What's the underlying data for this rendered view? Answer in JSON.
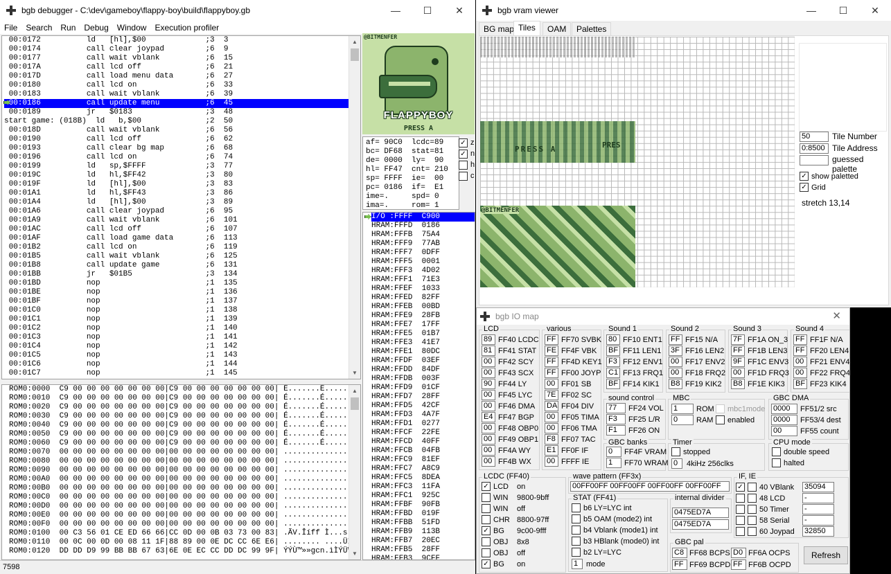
{
  "debugger": {
    "title": "bgb debugger - C:\\dev\\gameboy\\flappy-boy\\build\\flappyboy.gb",
    "menu": [
      "File",
      "Search",
      "Run",
      "Debug",
      "Window",
      "Execution profiler"
    ],
    "code": [
      " 00:0172          ld   [hl],$00             ;3  3",
      " 00:0174          call clear joypad         ;6  9",
      " 00:0177          call wait vblank          ;6  15",
      " 00:017A          call lcd off              ;6  21",
      " 00:017D          call load menu data       ;6  27",
      " 00:0180          call lcd on               ;6  33",
      " 00:0183          call wait vblank          ;6  39",
      " 00:0186          call update menu          ;6  45",
      " 00:0189          jr   $0183                ;3  48",
      "start game: (018B)  ld   b,$00              ;2  50",
      " 00:018D          call wait vblank          ;6  56",
      " 00:0190          call lcd off              ;6  62",
      " 00:0193          call clear bg map         ;6  68",
      " 00:0196          call lcd on               ;6  74",
      " 00:0199          ld   sp,$FFFF             ;3  77",
      " 00:019C          ld   hl,$FF42             ;3  80",
      " 00:019F          ld   [hl],$00             ;3  83",
      " 00:01A1          ld   hl,$FF43             ;3  86",
      " 00:01A4          ld   [hl],$00             ;3  89",
      " 00:01A6          call clear joypad         ;6  95",
      " 00:01A9          call wait vblank          ;6  101",
      " 00:01AC          call lcd off              ;6  107",
      " 00:01AF          call load game data       ;6  113",
      " 00:01B2          call lcd on               ;6  119",
      " 00:01B5          call wait vblank          ;6  125",
      " 00:01B8          call update game          ;6  131",
      " 00:01BB          jr   $01B5                ;3  134",
      " 00:01BD          nop                       ;1  135",
      " 00:01BE          nop                       ;1  136",
      " 00:01BF          nop                       ;1  137",
      " 00:01C0          nop                       ;1  138",
      " 00:01C1          nop                       ;1  139",
      " 00:01C2          nop                       ;1  140",
      " 00:01C3          nop                       ;1  141",
      " 00:01C4          nop                       ;1  142",
      " 00:01C5          nop                       ;1  143",
      " 00:01C6          nop                       ;1  144",
      " 00:01C7          nop                       ;1  145"
    ],
    "hex": [
      "ROM0:0000  C9 00 00 00 00 00 00 00|C9 00 00 00 00 00 00 00| É.......É.......",
      "ROM0:0010  C9 00 00 00 00 00 00 00|C9 00 00 00 00 00 00 00| É.......É.......",
      "ROM0:0020  C9 00 00 00 00 00 00 00|C9 00 00 00 00 00 00 00| É.......É.......",
      "ROM0:0030  C9 00 00 00 00 00 00 00|C9 00 00 00 00 00 00 00| É.......É.......",
      "ROM0:0040  C9 00 00 00 00 00 00 00|C9 00 00 00 00 00 00 00| É.......É.......",
      "ROM0:0050  C9 00 00 00 00 00 00 00|C9 00 00 00 00 00 00 00| É.......É.......",
      "ROM0:0060  C9 00 00 00 00 00 00 00|C9 00 00 00 00 00 00 00| É.......É.......",
      "ROM0:0070  00 00 00 00 00 00 00 00|00 00 00 00 00 00 00 00| ................",
      "ROM0:0080  00 00 00 00 00 00 00 00|00 00 00 00 00 00 00 00| ................",
      "ROM0:0090  00 00 00 00 00 00 00 00|00 00 00 00 00 00 00 00| ................",
      "ROM0:00A0  00 00 00 00 00 00 00 00|00 00 00 00 00 00 00 00| ................",
      "ROM0:00B0  00 00 00 00 00 00 00 00|00 00 00 00 00 00 00 00| ................",
      "ROM0:00C0  00 00 00 00 00 00 00 00|00 00 00 00 00 00 00 00| ................",
      "ROM0:00D0  00 00 00 00 00 00 00 00|00 00 00 00 00 00 00 00| ................",
      "ROM0:00E0  00 00 00 00 00 00 00 00|00 00 00 00 00 00 00 00| ................",
      "ROM0:00F0  00 00 00 00 00 00 00 00|00 00 00 00 00 00 00 00| ................",
      "ROM0:0100  00 C3 56 01 CE ED 66 66|CC 0D 00 0B 03 73 00 83| .ÃV.Îíff Ì...s..",
      "ROM0:0110  00 0C 00 0D 00 08 11 1F|88 89 00 0E DC CC 6E E6| ........ ....ÜÌnæ",
      "ROM0:0120  DD DD D9 99 BB BB 67 63|6E 0E EC CC DD DC 99 9F| ÝÝÙ™»»gcn.ìÌÝÜ™Ÿ"
    ],
    "regs": [
      "af= 90C0  lcdc=89",
      "bc= DF68  stat=81",
      "de= 0000  ly=  90",
      "hl= FF47  cnt= 210",
      "sp= FFFF  ie=  00",
      "pc= 0186  if=  E1",
      "ime=.     spd= 0",
      "ima=.     rom= 1"
    ],
    "flags": [
      "z",
      "n",
      "h",
      "c"
    ],
    "flags_checked": [
      true,
      true,
      false,
      false
    ],
    "stack": [
      "I/O :FFFF  C900",
      "HRAM:FFFD  0186",
      "HRAM:FFFB  75A4",
      "HRAM:FFF9  77AB",
      "HRAM:FFF7  0DFF",
      "HRAM:FFF5  0001",
      "HRAM:FFF3  4D02",
      "HRAM:FFF1  71E3",
      "HRAM:FFEF  1033",
      "HRAM:FFED  82FF",
      "HRAM:FFEB  00BD",
      "HRAM:FFE9  28FB",
      "HRAM:FFE7  17FF",
      "HRAM:FFE5  01B7",
      "HRAM:FFE3  41E7",
      "HRAM:FFE1  80DC",
      "HRAM:FFDF  03EF",
      "HRAM:FFDD  84DF",
      "HRAM:FFDB  003F",
      "HRAM:FFD9  01CF",
      "HRAM:FFD7  28FF",
      "HRAM:FFD5  42CF",
      "HRAM:FFD3  4A7F",
      "HRAM:FFD1  0277",
      "HRAM:FFCF  22FE",
      "HRAM:FFCD  40FF",
      "HRAM:FFCB  04FB",
      "HRAM:FFC9  81EF",
      "HRAM:FFC7  A8C9",
      "HRAM:FFC5  8DEA",
      "HRAM:FFC3  11FA",
      "HRAM:FFC1  925C",
      "HRAM:FFBF  90FB",
      "HRAM:FFBD  019F",
      "HRAM:FFBB  51FD",
      "HRAM:FFB9  113B",
      "HRAM:FFB7  20EC",
      "HRAM:FFB5  28FF",
      "HRAM:FFB3  9CFF"
    ],
    "screen_brand": "@BITMENFER",
    "screen_title": "FLAPPYBOY",
    "screen_press": "PRESS A",
    "status": "7598"
  },
  "vram": {
    "title": "bgb vram viewer",
    "tabs": [
      "BG map",
      "Tiles",
      "OAM",
      "Palettes"
    ],
    "tile_number": "50",
    "tile_number_label": "Tile Number",
    "tile_address": "0:8500",
    "tile_address_label": "Tile Address",
    "guessed_palette": "guessed palette",
    "show_paletted": "show paletted",
    "grid": "Grid",
    "stretch": "stretch 13,14",
    "tile_text1": "@BITMENFER",
    "tile_text2": "PRESS A",
    "tile_text3": "PRES"
  },
  "iomap": {
    "title": "bgb IO map",
    "lcd": {
      "title": "LCD",
      "rows": [
        [
          "89",
          "FF40 LCDC"
        ],
        [
          "81",
          "FF41 STAT"
        ],
        [
          "00",
          "FF42 SCY"
        ],
        [
          "00",
          "FF43 SCX"
        ],
        [
          "90",
          "FF44 LY"
        ],
        [
          "00",
          "FF45 LYC"
        ],
        [
          "00",
          "FF46 DMA"
        ],
        [
          "E4",
          "FF47 BGP"
        ],
        [
          "00",
          "FF48 OBP0"
        ],
        [
          "00",
          "FF49 OBP1"
        ],
        [
          "00",
          "FF4A WY"
        ],
        [
          "00",
          "FF4B WX"
        ]
      ]
    },
    "various": {
      "title": "various",
      "rows": [
        [
          "FF",
          "FF70 SVBK"
        ],
        [
          "FE",
          "FF4F VBK"
        ],
        [
          "FF",
          "FF4D KEY1"
        ],
        [
          "FF",
          "FF00 JOYP"
        ],
        [
          "00",
          "FF01 SB"
        ],
        [
          "7E",
          "FF02 SC"
        ],
        [
          "DA",
          "FF04 DIV"
        ],
        [
          "00",
          "FF05 TIMA"
        ],
        [
          "00",
          "FF06 TMA"
        ],
        [
          "F8",
          "FF07 TAC"
        ],
        [
          "E1",
          "FF0F IF"
        ],
        [
          "00",
          "FFFF IE"
        ]
      ]
    },
    "sound1": {
      "title": "Sound 1",
      "rows": [
        [
          "80",
          "FF10 ENT1"
        ],
        [
          "BF",
          "FF11 LEN1"
        ],
        [
          "F3",
          "FF12 ENV1"
        ],
        [
          "C1",
          "FF13 FRQ1"
        ],
        [
          "BF",
          "FF14 KIK1"
        ]
      ]
    },
    "sound2": {
      "title": "Sound 2",
      "rows": [
        [
          "FF",
          "FF15 N/A"
        ],
        [
          "3F",
          "FF16 LEN2"
        ],
        [
          "00",
          "FF17 ENV2"
        ],
        [
          "00",
          "FF18 FRQ2"
        ],
        [
          "B8",
          "FF19 KIK2"
        ]
      ]
    },
    "sound3": {
      "title": "Sound 3",
      "rows": [
        [
          "7F",
          "FF1A ON_3"
        ],
        [
          "FF",
          "FF1B LEN3"
        ],
        [
          "9F",
          "FF1C ENV3"
        ],
        [
          "00",
          "FF1D FRQ3"
        ],
        [
          "B8",
          "FF1E KIK3"
        ]
      ]
    },
    "sound4": {
      "title": "Sound 4",
      "rows": [
        [
          "FF",
          "FF1F N/A"
        ],
        [
          "FF",
          "FF20 LEN4"
        ],
        [
          "00",
          "FF21 ENV4"
        ],
        [
          "00",
          "FF22 FRQ4"
        ],
        [
          "BF",
          "FF23 KIK4"
        ]
      ]
    },
    "soundctl": {
      "title": "sound control",
      "rows": [
        [
          "77",
          "FF24 VOL"
        ],
        [
          "F3",
          "FF25 L/R"
        ],
        [
          "F1",
          "FF26 ON"
        ]
      ]
    },
    "mbc": {
      "title": "MBC",
      "rom": "1",
      "rom_label": "ROM",
      "ram": "0",
      "ram_label": "RAM",
      "mbc1mode": "mbc1mode",
      "enabled": "enabled"
    },
    "gbcdma": {
      "title": "GBC DMA",
      "rows": [
        [
          "0000",
          "FF51/2 src"
        ],
        [
          "0000",
          "FF53/4 dest"
        ],
        [
          "00",
          "FF55 count"
        ]
      ]
    },
    "gbcbanks": {
      "title": "GBC banks",
      "rows": [
        [
          "0",
          "FF4F VRAM"
        ],
        [
          "1",
          "FF70 WRAM"
        ]
      ]
    },
    "timer": {
      "title": "Timer",
      "stopped": "stopped",
      "val": "0",
      "clk": "4kiHz 256clks"
    },
    "cpumode": {
      "title": "CPU mode",
      "double": "double speed",
      "halted": "halted"
    },
    "lcdc": {
      "title": "LCDC (FF40)",
      "rows": [
        [
          "LCD",
          "on",
          true
        ],
        [
          "WIN",
          "9800-9bff",
          false
        ],
        [
          "WIN",
          "off",
          false
        ],
        [
          "CHR",
          "8800-97ff",
          false
        ],
        [
          "BG",
          "9c00-9fff",
          true
        ],
        [
          "OBJ",
          "8x8",
          false
        ],
        [
          "OBJ",
          "off",
          false
        ],
        [
          "BG",
          "on",
          true
        ]
      ]
    },
    "wave": {
      "title": "wave pattern (FF3x)",
      "value": "00FF00FF 00FF00FF 00FF00FF 00FF00FF"
    },
    "stat": {
      "title": "STAT (FF41)",
      "rows": [
        "b6 LY=LYC int",
        "b5 OAM (mode2) int",
        "b4 Vblank (mode1) int",
        "b3 HBlank (mode0) int",
        "b2 LY=LYC"
      ],
      "mode": "1",
      "mode_label": "mode"
    },
    "divider": {
      "title": "internal divider",
      "v1": "0475ED7A",
      "v2": "0475ED7A"
    },
    "ifie": {
      "title": "IF, IE",
      "rows": [
        [
          "40 VBlank",
          "35094",
          true
        ],
        [
          "48 LCD",
          "-",
          false
        ],
        [
          "50 Timer",
          "-",
          false
        ],
        [
          "58 Serial",
          "-",
          false
        ],
        [
          "60 Joypad",
          "32850",
          false
        ]
      ]
    },
    "gbcpal": {
      "title": "GBC pal",
      "r1a": "C8",
      "r1b": "FF68 BCPS",
      "r1c": "D0",
      "r1d": "FF6A OCPS",
      "r2a": "FF",
      "r2b": "FF69 BCPD",
      "r2c": "FF",
      "r2d": "FF6B OCPD"
    },
    "refresh": "Refresh"
  },
  "colors": {
    "gb_light": "#c6e0a6",
    "gb_mid": "#8cb46c",
    "gb_dark": "#3c6e3c",
    "gb_darkest": "#1e3c1e",
    "highlight": "#0000ff"
  }
}
